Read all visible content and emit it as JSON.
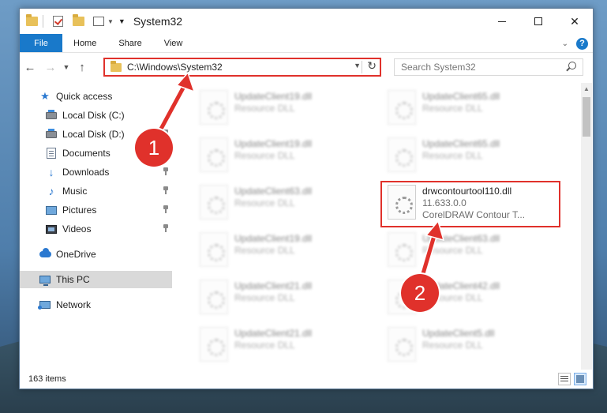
{
  "window": {
    "title": "System32",
    "controls": {
      "minimize": "minimize",
      "maximize": "maximize",
      "close": "✕"
    }
  },
  "ribbon": {
    "tabs": [
      {
        "label": "File"
      },
      {
        "label": "Home"
      },
      {
        "label": "Share"
      },
      {
        "label": "View"
      }
    ],
    "help": "?"
  },
  "address": {
    "path": "C:\\Windows\\System32",
    "search_placeholder": "Search System32"
  },
  "sidebar": {
    "items": [
      {
        "label": "Quick access",
        "icon": "star-icon"
      },
      {
        "label": "Local Disk (C:)",
        "icon": "drive-icon"
      },
      {
        "label": "Local Disk (D:)",
        "icon": "drive-icon"
      },
      {
        "label": "Documents",
        "icon": "documents-icon"
      },
      {
        "label": "Downloads",
        "icon": "downloads-icon"
      },
      {
        "label": "Music",
        "icon": "music-icon"
      },
      {
        "label": "Pictures",
        "icon": "pictures-icon"
      },
      {
        "label": "Videos",
        "icon": "videos-icon"
      },
      {
        "label": "OneDrive",
        "icon": "onedrive-icon"
      },
      {
        "label": "This PC",
        "icon": "this-pc-icon"
      },
      {
        "label": "Network",
        "icon": "network-icon"
      }
    ]
  },
  "files": {
    "left": [
      {
        "name": "UpdateClient19.dll",
        "type": "Resource DLL"
      },
      {
        "name": "UpdateClient19.dll",
        "type": "Resource DLL"
      },
      {
        "name": "UpdateClient63.dll",
        "type": "Resource DLL"
      },
      {
        "name": "UpdateClient19.dll",
        "type": "Resource DLL"
      },
      {
        "name": "UpdateClient21.dll",
        "type": "Resource DLL"
      },
      {
        "name": "UpdateClient21.dll",
        "type": "Resource DLL"
      }
    ],
    "right": [
      {
        "name": "UpdateClient65.dll",
        "type": "Resource DLL"
      },
      {
        "name": "UpdateClient65.dll",
        "type": "Resource DLL"
      },
      {
        "name": "UpdateClient63.dll",
        "type": "Resource DLL"
      },
      {
        "name": "UpdateClient42.dll",
        "type": "Resource DLL"
      },
      {
        "name": "UpdateClient5.dll",
        "type": "Resource DLL"
      }
    ],
    "featured": {
      "name": "drwcontourtool110.dll",
      "version": "11.633.0.0",
      "description": "CorelDRAW Contour T..."
    }
  },
  "status": {
    "count": "163 items"
  },
  "annotations": {
    "step1": "1",
    "step2": "2"
  },
  "colors": {
    "accent": "#1979ca",
    "annotation": "#e0312b"
  }
}
